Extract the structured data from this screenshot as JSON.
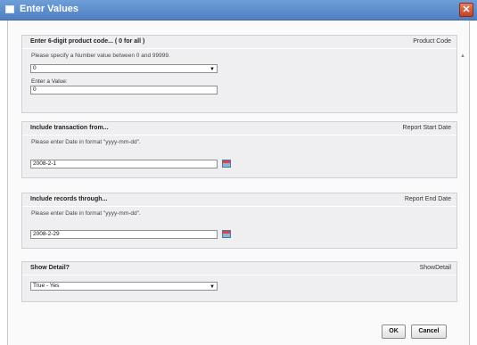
{
  "dialog": {
    "title": "Enter Values",
    "close_glyph": "✕"
  },
  "sections": [
    {
      "title": "Enter 6-digit product code... ( 0 for all )",
      "tag": "Product Code",
      "hint": "Please specify a Number value between 0 and 99999.",
      "select_value": "0",
      "value_label": "Enter a Value:",
      "value_input": "0"
    },
    {
      "title": "Include transaction from...",
      "tag": "Report Start Date",
      "hint": "Please enter Date in format \"yyyy-mm-dd\".",
      "value_input": "2008-2-1"
    },
    {
      "title": "Include records through...",
      "tag": "Report End Date",
      "hint": "Please enter Date in format \"yyyy-mm-dd\".",
      "value_input": "2008-2-29"
    },
    {
      "title": "Show Detail?",
      "tag": "ShowDetail",
      "select_value": "True - Yes"
    }
  ],
  "buttons": {
    "ok": "OK",
    "cancel": "Cancel"
  },
  "icons": {
    "dropdown": "chevron-down-icon",
    "calendar": "calendar-icon",
    "scroll_up": "scroll-up-icon",
    "dialog": "dialog-window-icon"
  }
}
